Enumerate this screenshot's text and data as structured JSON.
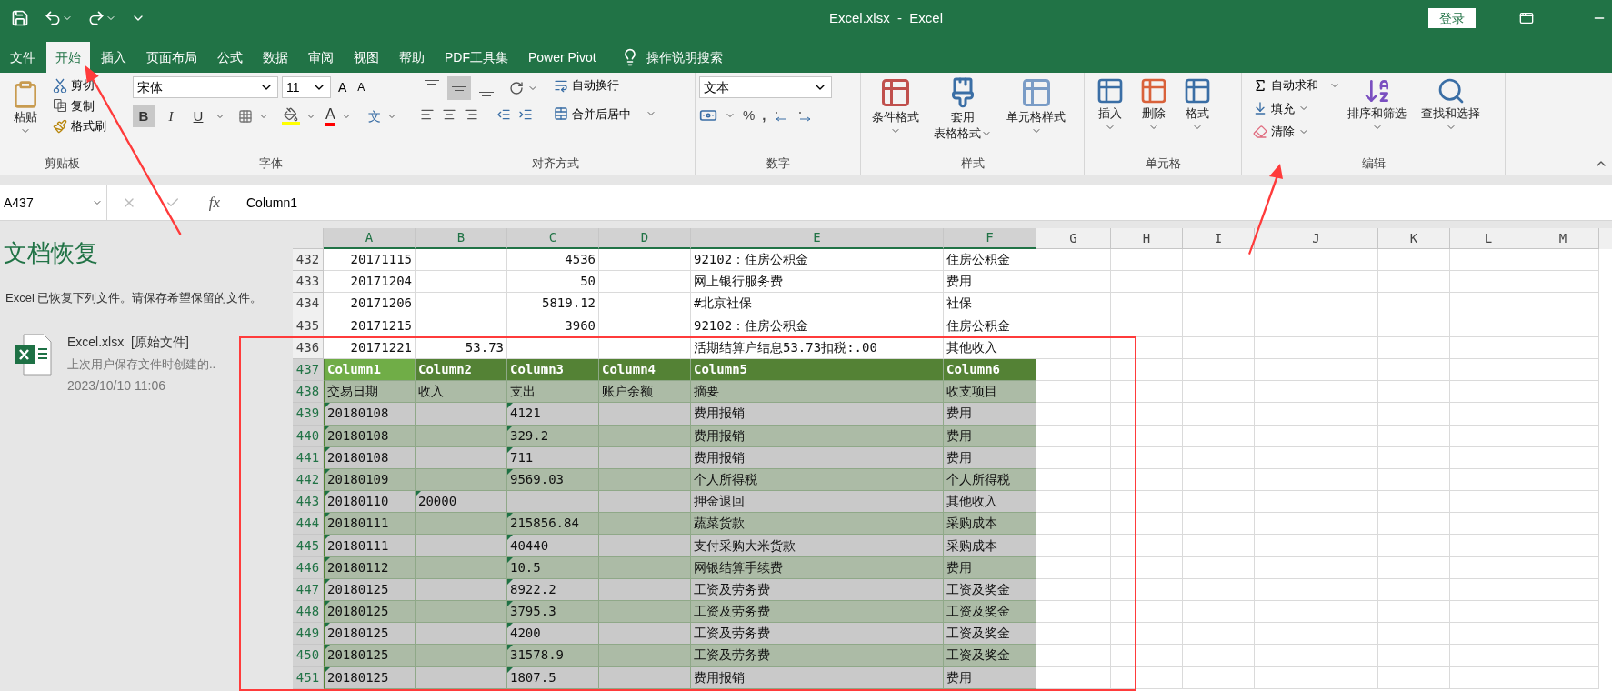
{
  "window": {
    "title": "Excel.xlsx  -  Excel",
    "sign_in": "登录"
  },
  "tabs": [
    {
      "label": "文件",
      "selected": false
    },
    {
      "label": "开始",
      "selected": true
    },
    {
      "label": "插入",
      "selected": false
    },
    {
      "label": "页面布局",
      "selected": false
    },
    {
      "label": "公式",
      "selected": false
    },
    {
      "label": "数据",
      "selected": false
    },
    {
      "label": "审阅",
      "selected": false
    },
    {
      "label": "视图",
      "selected": false
    },
    {
      "label": "帮助",
      "selected": false
    },
    {
      "label": "PDF工具集",
      "selected": false
    },
    {
      "label": "Power Pivot",
      "selected": false
    }
  ],
  "tell_me": "操作说明搜索",
  "ribbon": {
    "clipboard": {
      "title": "剪贴板",
      "paste": "粘贴",
      "cut": "剪切",
      "copy": "复制",
      "format_painter": "格式刷"
    },
    "font": {
      "title": "字体",
      "font_name": "宋体",
      "font_size": "11",
      "grow": "A",
      "shrink": "A",
      "font_color": "A",
      "styles": [
        {
          "kind": "bold",
          "glyph": "B",
          "selected": true
        },
        {
          "kind": "italic",
          "glyph": "I",
          "selected": false
        },
        {
          "kind": "underline",
          "glyph": "U",
          "selected": false
        }
      ],
      "phonetic": "文"
    },
    "alignment": {
      "title": "对齐方式",
      "vertical": [
        {
          "kind": "top",
          "selected": false
        },
        {
          "kind": "middle",
          "selected": true
        },
        {
          "kind": "bottom",
          "selected": false
        }
      ],
      "wrap": "自动换行",
      "merge": "合并后居中"
    },
    "number": {
      "title": "数字",
      "format": "文本",
      "percent": "%",
      "comma": ","
    },
    "styles": {
      "title": "样式",
      "conditional": "条件格式",
      "table_lines": [
        "套用",
        "表格格式"
      ],
      "cell_styles": "单元格样式"
    },
    "cells": {
      "title": "单元格",
      "insert": "插入",
      "delete": "删除",
      "format": "格式"
    },
    "editing": {
      "title": "编辑",
      "autosum": "自动求和",
      "fill": "填充",
      "clear": "清除",
      "sort": "排序和筛选",
      "find": "查找和选择"
    }
  },
  "formula_bar": {
    "name_box": "A437",
    "function_label": "fx",
    "content": "Column1"
  },
  "recovery": {
    "title": "文档恢复",
    "message": "Excel 已恢复下列文件。请保存希望保留的文件。",
    "file": {
      "name": "Excel.xlsx  [原始文件]",
      "note": "上次用户保存文件时创建的..",
      "date": "2023/10/10 11:06"
    }
  },
  "sheet": {
    "columns": [
      {
        "label": "A",
        "selected": true
      },
      {
        "label": "B",
        "selected": true
      },
      {
        "label": "C",
        "selected": true
      },
      {
        "label": "D",
        "selected": true
      },
      {
        "label": "E",
        "selected": true
      },
      {
        "label": "F",
        "selected": true
      },
      {
        "label": "G",
        "selected": false
      },
      {
        "label": "H",
        "selected": false
      },
      {
        "label": "I",
        "selected": false
      },
      {
        "label": "J",
        "selected": false
      },
      {
        "label": "K",
        "selected": false
      },
      {
        "label": "L",
        "selected": false
      },
      {
        "label": "M",
        "selected": false
      }
    ],
    "rows": [
      {
        "number": "432",
        "kind": "plain",
        "selected": false,
        "cells": [
          {
            "text": "20171115",
            "flag": false,
            "selected": false
          },
          {
            "flag": false,
            "selected": false
          },
          {
            "text": "4536",
            "flag": false,
            "selected": false
          },
          {
            "flag": false,
            "selected": false
          },
          {
            "text": "92102：住房公积金",
            "flag": false,
            "selected": false
          },
          {
            "text": "住房公积金",
            "flag": false,
            "selected": false
          }
        ]
      },
      {
        "number": "433",
        "kind": "plain",
        "selected": false,
        "cells": [
          {
            "text": "20171204",
            "flag": false,
            "selected": false
          },
          {
            "flag": false,
            "selected": false
          },
          {
            "text": "50",
            "flag": false,
            "selected": false
          },
          {
            "flag": false,
            "selected": false
          },
          {
            "text": "网上银行服务费",
            "flag": false,
            "selected": false
          },
          {
            "text": "费用",
            "flag": false,
            "selected": false
          }
        ]
      },
      {
        "number": "434",
        "kind": "plain",
        "selected": false,
        "cells": [
          {
            "text": "20171206",
            "flag": false,
            "selected": false
          },
          {
            "flag": false,
            "selected": false
          },
          {
            "text": "5819.12",
            "flag": false,
            "selected": false
          },
          {
            "flag": false,
            "selected": false
          },
          {
            "text": "#北京社保",
            "flag": false,
            "selected": false
          },
          {
            "text": "社保",
            "flag": false,
            "selected": false
          }
        ]
      },
      {
        "number": "435",
        "kind": "plain",
        "selected": false,
        "cells": [
          {
            "text": "20171215",
            "flag": false,
            "selected": false
          },
          {
            "flag": false,
            "selected": false
          },
          {
            "text": "3960",
            "flag": false,
            "selected": false
          },
          {
            "flag": false,
            "selected": false
          },
          {
            "text": "92102：住房公积金",
            "flag": false,
            "selected": false
          },
          {
            "text": "住房公积金",
            "flag": false,
            "selected": false
          }
        ]
      },
      {
        "number": "436",
        "kind": "plain",
        "selected": false,
        "cells": [
          {
            "text": "20171221",
            "flag": false,
            "selected": false
          },
          {
            "text": "53.73",
            "flag": false,
            "selected": false
          },
          {
            "flag": false,
            "selected": false
          },
          {
            "flag": false,
            "selected": false
          },
          {
            "text": "活期结算户结息53.73扣税:.00",
            "flag": false,
            "selected": false
          },
          {
            "text": "其他收入",
            "flag": false,
            "selected": false
          }
        ]
      },
      {
        "number": "437",
        "kind": "header",
        "selected": true,
        "cells": [
          {
            "text": "Column1",
            "flag": false,
            "selected": true
          },
          {
            "text": "Column2",
            "flag": false,
            "selected": false
          },
          {
            "text": "Column3",
            "flag": false,
            "selected": false
          },
          {
            "text": "Column4",
            "flag": false,
            "selected": false
          },
          {
            "text": "Column5",
            "flag": false,
            "selected": false
          },
          {
            "text": "Column6",
            "flag": false,
            "selected": false
          }
        ]
      },
      {
        "number": "438",
        "kind": "body",
        "selected": true,
        "cells": [
          {
            "text": "交易日期",
            "flag": false,
            "selected": false
          },
          {
            "text": "收入",
            "flag": false,
            "selected": false
          },
          {
            "text": "支出",
            "flag": false,
            "selected": false
          },
          {
            "text": "账户余额",
            "flag": false,
            "selected": false
          },
          {
            "text": "摘要",
            "flag": false,
            "selected": false
          },
          {
            "text": "收支项目",
            "flag": false,
            "selected": false
          }
        ]
      },
      {
        "number": "439",
        "kind": "body",
        "selected": true,
        "cells": [
          {
            "text": "20180108",
            "flag": true,
            "selected": false
          },
          {
            "flag": false,
            "selected": false
          },
          {
            "text": "4121",
            "flag": true,
            "selected": false
          },
          {
            "flag": false,
            "selected": false
          },
          {
            "text": "费用报销",
            "flag": false,
            "selected": false
          },
          {
            "text": "费用",
            "flag": false,
            "selected": false
          }
        ]
      },
      {
        "number": "440",
        "kind": "body",
        "selected": true,
        "cells": [
          {
            "text": "20180108",
            "flag": true,
            "selected": false
          },
          {
            "flag": false,
            "selected": false
          },
          {
            "text": "329.2",
            "flag": true,
            "selected": false
          },
          {
            "flag": false,
            "selected": false
          },
          {
            "text": "费用报销",
            "flag": false,
            "selected": false
          },
          {
            "text": "费用",
            "flag": false,
            "selected": false
          }
        ]
      },
      {
        "number": "441",
        "kind": "body",
        "selected": true,
        "cells": [
          {
            "text": "20180108",
            "flag": true,
            "selected": false
          },
          {
            "flag": false,
            "selected": false
          },
          {
            "text": "711",
            "flag": true,
            "selected": false
          },
          {
            "flag": false,
            "selected": false
          },
          {
            "text": "费用报销",
            "flag": false,
            "selected": false
          },
          {
            "text": "费用",
            "flag": false,
            "selected": false
          }
        ]
      },
      {
        "number": "442",
        "kind": "body",
        "selected": true,
        "cells": [
          {
            "text": "20180109",
            "flag": true,
            "selected": false
          },
          {
            "flag": false,
            "selected": false
          },
          {
            "text": "9569.03",
            "flag": true,
            "selected": false
          },
          {
            "flag": false,
            "selected": false
          },
          {
            "text": "个人所得税",
            "flag": false,
            "selected": false
          },
          {
            "text": "个人所得税",
            "flag": false,
            "selected": false
          }
        ]
      },
      {
        "number": "443",
        "kind": "body",
        "selected": true,
        "cells": [
          {
            "text": "20180110",
            "flag": true,
            "selected": false
          },
          {
            "text": "20000",
            "flag": true,
            "selected": false
          },
          {
            "flag": false,
            "selected": false
          },
          {
            "flag": false,
            "selected": false
          },
          {
            "text": "押金退回",
            "flag": false,
            "selected": false
          },
          {
            "text": "其他收入",
            "flag": false,
            "selected": false
          }
        ]
      },
      {
        "number": "444",
        "kind": "body",
        "selected": true,
        "cells": [
          {
            "text": "20180111",
            "flag": true,
            "selected": false
          },
          {
            "flag": false,
            "selected": false
          },
          {
            "text": "215856.84",
            "flag": true,
            "selected": false
          },
          {
            "flag": false,
            "selected": false
          },
          {
            "text": "蔬菜货款",
            "flag": false,
            "selected": false
          },
          {
            "text": "采购成本",
            "flag": false,
            "selected": false
          }
        ]
      },
      {
        "number": "445",
        "kind": "body",
        "selected": true,
        "cells": [
          {
            "text": "20180111",
            "flag": true,
            "selected": false
          },
          {
            "flag": false,
            "selected": false
          },
          {
            "text": "40440",
            "flag": true,
            "selected": false
          },
          {
            "flag": false,
            "selected": false
          },
          {
            "text": "支付采购大米货款",
            "flag": false,
            "selected": false
          },
          {
            "text": "采购成本",
            "flag": false,
            "selected": false
          }
        ]
      },
      {
        "number": "446",
        "kind": "body",
        "selected": true,
        "cells": [
          {
            "text": "20180112",
            "flag": true,
            "selected": false
          },
          {
            "flag": false,
            "selected": false
          },
          {
            "text": "10.5",
            "flag": true,
            "selected": false
          },
          {
            "flag": false,
            "selected": false
          },
          {
            "text": "网银结算手续费",
            "flag": false,
            "selected": false
          },
          {
            "text": "费用",
            "flag": false,
            "selected": false
          }
        ]
      },
      {
        "number": "447",
        "kind": "body",
        "selected": true,
        "cells": [
          {
            "text": "20180125",
            "flag": true,
            "selected": false
          },
          {
            "flag": false,
            "selected": false
          },
          {
            "text": "8922.2",
            "flag": true,
            "selected": false
          },
          {
            "flag": false,
            "selected": false
          },
          {
            "text": "工资及劳务费",
            "flag": false,
            "selected": false
          },
          {
            "text": "工资及奖金",
            "flag": false,
            "selected": false
          }
        ]
      },
      {
        "number": "448",
        "kind": "body",
        "selected": true,
        "cells": [
          {
            "text": "20180125",
            "flag": true,
            "selected": false
          },
          {
            "flag": false,
            "selected": false
          },
          {
            "text": "3795.3",
            "flag": true,
            "selected": false
          },
          {
            "flag": false,
            "selected": false
          },
          {
            "text": "工资及劳务费",
            "flag": false,
            "selected": false
          },
          {
            "text": "工资及奖金",
            "flag": false,
            "selected": false
          }
        ]
      },
      {
        "number": "449",
        "kind": "body",
        "selected": true,
        "cells": [
          {
            "text": "20180125",
            "flag": true,
            "selected": false
          },
          {
            "flag": false,
            "selected": false
          },
          {
            "text": "4200",
            "flag": true,
            "selected": false
          },
          {
            "flag": false,
            "selected": false
          },
          {
            "text": "工资及劳务费",
            "flag": false,
            "selected": false
          },
          {
            "text": "工资及奖金",
            "flag": false,
            "selected": false
          }
        ]
      },
      {
        "number": "450",
        "kind": "body",
        "selected": true,
        "cells": [
          {
            "text": "20180125",
            "flag": true,
            "selected": false
          },
          {
            "flag": false,
            "selected": false
          },
          {
            "text": "31578.9",
            "flag": true,
            "selected": false
          },
          {
            "flag": false,
            "selected": false
          },
          {
            "text": "工资及劳务费",
            "flag": false,
            "selected": false
          },
          {
            "text": "工资及奖金",
            "flag": false,
            "selected": false
          }
        ]
      },
      {
        "number": "451",
        "kind": "body",
        "selected": true,
        "cells": [
          {
            "text": "20180125",
            "flag": true,
            "selected": false
          },
          {
            "flag": false,
            "selected": false
          },
          {
            "text": "1807.5",
            "flag": true,
            "selected": false
          },
          {
            "flag": false,
            "selected": false
          },
          {
            "text": "费用报销",
            "flag": false,
            "selected": false
          },
          {
            "text": "费用",
            "flag": false,
            "selected": false
          }
        ]
      }
    ]
  }
}
